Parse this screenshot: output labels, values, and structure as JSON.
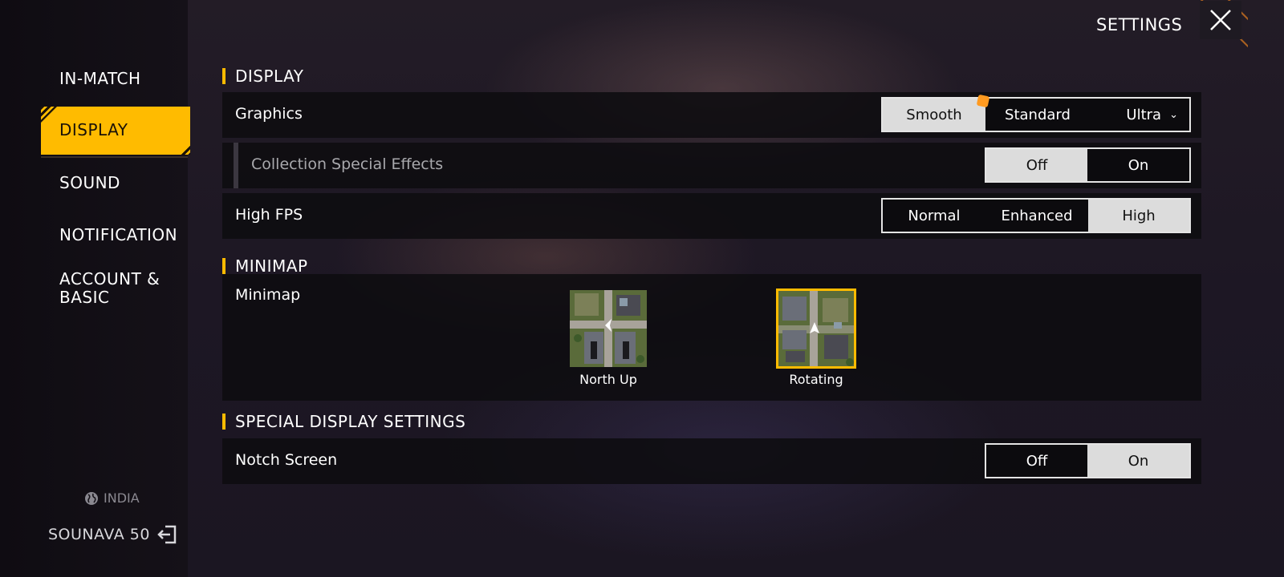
{
  "header": {
    "title": "SETTINGS",
    "close_icon": "close-icon"
  },
  "sidebar": {
    "items": [
      {
        "label": "IN-MATCH"
      },
      {
        "label": "DISPLAY",
        "active": true
      },
      {
        "label": "SOUND"
      },
      {
        "label": "NOTIFICATION"
      },
      {
        "label": "ACCOUNT & BASIC"
      }
    ],
    "region": "INDIA",
    "username": "SOUNAVA 50"
  },
  "display": {
    "section_title": "DISPLAY",
    "graphics": {
      "label": "Graphics",
      "help": "?",
      "options": [
        "Smooth",
        "Standard",
        "Ultra"
      ],
      "selected": "Smooth"
    },
    "collection_effects": {
      "label": "Collection Special Effects",
      "options": [
        "Off",
        "On"
      ],
      "selected": "Off"
    },
    "high_fps": {
      "label": "High FPS",
      "options": [
        "Normal",
        "Enhanced",
        "High"
      ],
      "selected": "High"
    }
  },
  "minimap": {
    "section_title": "MINIMAP",
    "label": "Minimap",
    "options": [
      "North Up",
      "Rotating"
    ],
    "selected": "Rotating"
  },
  "special": {
    "section_title": "SPECIAL DISPLAY SETTINGS",
    "notch": {
      "label": "Notch Screen",
      "options": [
        "Off",
        "On"
      ],
      "selected": "On"
    }
  },
  "colors": {
    "accent": "#ffbb00",
    "selected_option": "#dcdcdc"
  }
}
